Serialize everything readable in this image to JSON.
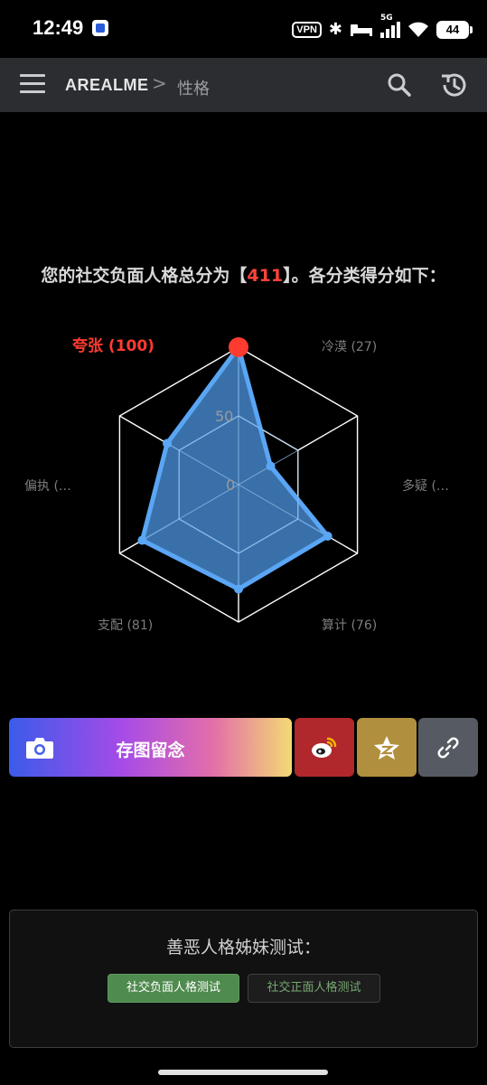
{
  "status_bar": {
    "time": "12:49",
    "vpn": "VPN",
    "network": "5G",
    "battery": "44"
  },
  "navbar": {
    "brand": "AREALME",
    "separator": ">",
    "breadcrumb": "性格"
  },
  "result": {
    "prefix": "您的社交负面人格总分为【",
    "total_score": "411",
    "suffix": "】。各分类得分如下："
  },
  "chart_data": {
    "type": "radar",
    "max": 100,
    "rings": [
      0,
      50,
      100
    ],
    "ring_labels": [
      "0",
      "50"
    ],
    "grid": true,
    "categories": [
      "夸张",
      "冷漠",
      "多疑",
      "算计",
      "支配",
      "偏执"
    ],
    "display_labels": [
      "夸张 (100)",
      "冷漠 (27)",
      "多疑 (…",
      "算计 (76)",
      "支配 (81)",
      "偏执 (…"
    ],
    "values": [
      100,
      27,
      75,
      76,
      81,
      60
    ],
    "highlight_index": 0,
    "colors": {
      "fill": "#4a90d9",
      "stroke": "#5aa6f5",
      "grid": "#ffffff",
      "label": "#7d7d7d",
      "highlight": "#ff3b30"
    }
  },
  "actions": {
    "save_label": "存图留念",
    "camera_icon": "camera-icon",
    "weibo_icon": "weibo-icon",
    "qzone_icon": "qzone-star-icon",
    "link_icon": "link-icon",
    "colors": {
      "weibo": "#b0272c",
      "qzone": "#b08f3e",
      "link": "#565a62"
    }
  },
  "sister_tests": {
    "title": "善恶人格姊妹测试：",
    "negative_label": "社交负面人格测试",
    "positive_label": "社交正面人格测试"
  }
}
